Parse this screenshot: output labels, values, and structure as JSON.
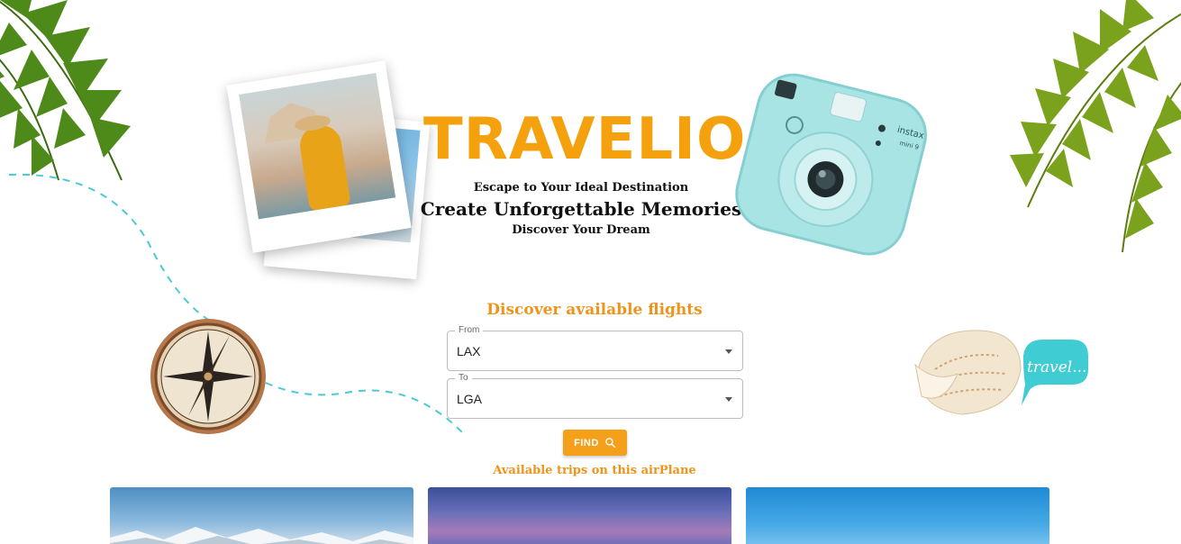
{
  "brand": {
    "title": "TRAVELIO",
    "tagline_1": "Escape to Your Ideal Destination",
    "tagline_2": "Create Unforgettable Memories",
    "tagline_3": "Discover Your Dream"
  },
  "search": {
    "title": "Discover available flights",
    "from": {
      "label": "From",
      "value": "LAX"
    },
    "to": {
      "label": "To",
      "value": "LGA"
    },
    "find_label": "FIND"
  },
  "trips": {
    "title": "Available trips on this airPlane"
  },
  "decor": {
    "bubble_text": "travel...",
    "camera_brand": "instax",
    "camera_model": "mini 9"
  },
  "colors": {
    "accent": "#f5a00d",
    "bubble": "#3fcdd3",
    "camera": "#a9e4e4"
  }
}
